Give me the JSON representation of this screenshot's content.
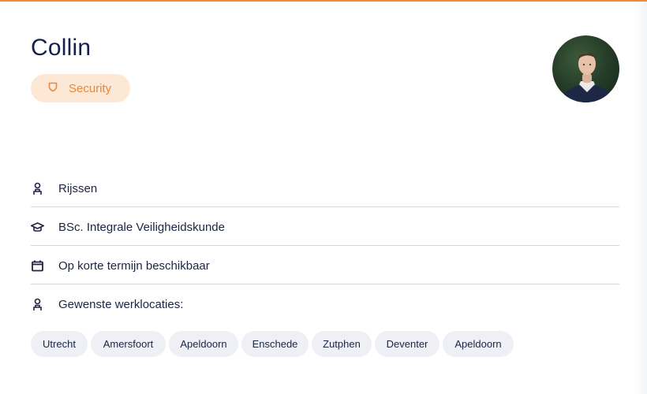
{
  "colors": {
    "accent": "#ee8a3a",
    "badge_bg": "#fde8d6",
    "badge_text": "#e8883b",
    "chip_bg": "#eef0f6",
    "text_dark": "#15214a",
    "divider": "#d5d8de"
  },
  "profile": {
    "name": "Collin",
    "badge": {
      "label": "Security",
      "icon": "shield-icon"
    },
    "avatar": {
      "icon": "profile-photo"
    }
  },
  "details": [
    {
      "icon": "person-pin-icon",
      "text": "Rijssen"
    },
    {
      "icon": "graduation-cap-icon",
      "text": "BSc. Integrale Veiligheidskunde"
    },
    {
      "icon": "calendar-icon",
      "text": "Op korte termijn beschikbaar"
    },
    {
      "icon": "person-pin-icon",
      "text": "Gewenste werklocaties:"
    }
  ],
  "locations": [
    "Utrecht",
    "Amersfoort",
    "Apeldoorn",
    "Enschede",
    "Zutphen",
    "Deventer",
    "Apeldoorn"
  ]
}
